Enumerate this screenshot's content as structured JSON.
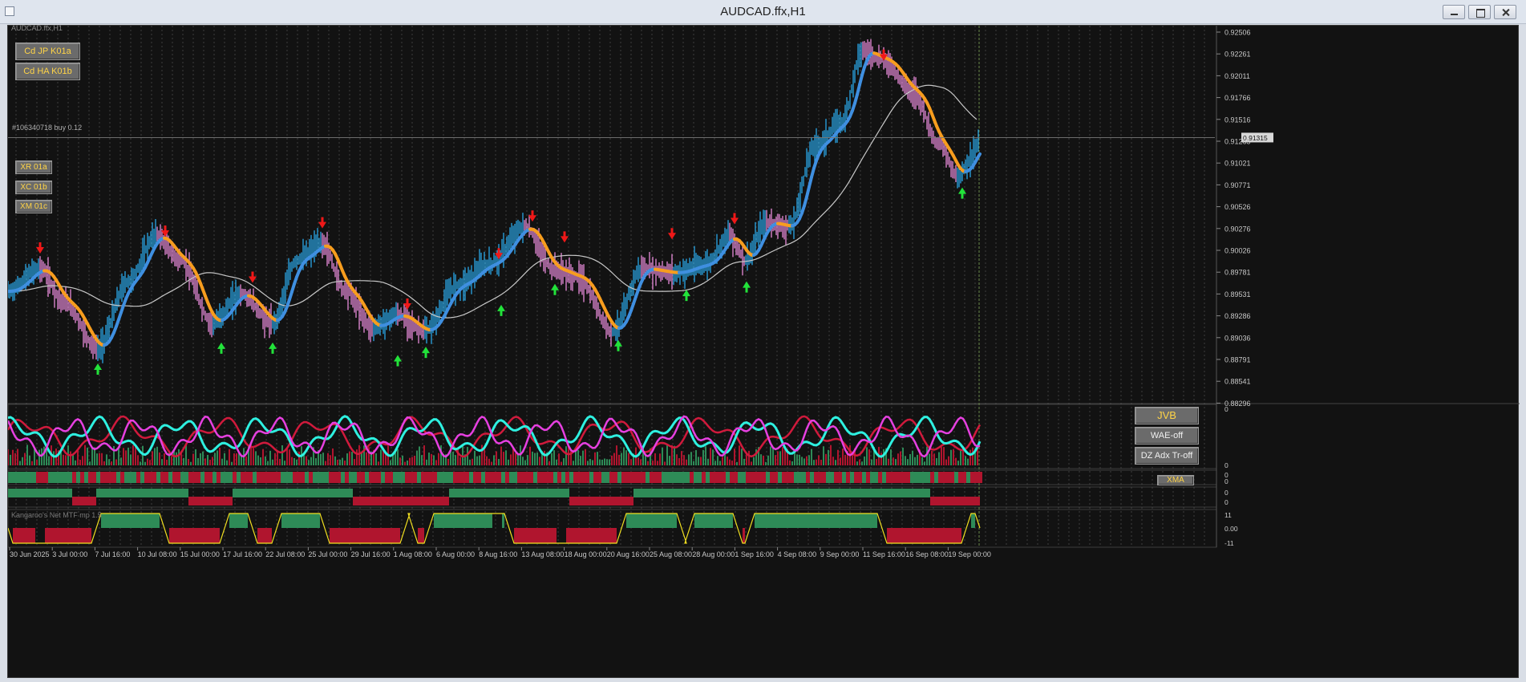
{
  "window": {
    "title": "AUDCAD.ffx,H1",
    "chart_label": "AUDCAD.ffx,H1"
  },
  "buttons": {
    "cd_jp": "Cd JP K01a",
    "cd_ha": "Cd HA K01b",
    "xr": "XR 01a",
    "xc": "XC 01b",
    "xm": "XM 01c",
    "jvb": "JVB",
    "wae": "WAE-off",
    "dz": "DZ Adx Tr-off",
    "xma": "XMA"
  },
  "order_label": "#106340718 buy 0.12",
  "current_price": "0.91315",
  "indicator_label": "Kangaroo's Net MTF mp 1.5",
  "price_axis": [
    "0.92506",
    "0.92261",
    "0.92011",
    "0.91766",
    "0.91516",
    "0.91265",
    "0.91021",
    "0.90771",
    "0.90526",
    "0.90276",
    "0.90026",
    "0.89781",
    "0.89531",
    "0.89286",
    "0.89036",
    "0.88791",
    "0.88541",
    "0.88296"
  ],
  "sub_axis": {
    "osc_top": "0",
    "osc_bottom": "0",
    "bar1_a": "0",
    "bar1_b": "0",
    "bar2_a": "0",
    "bar2_b": "0",
    "kn_top": "11",
    "kn_mid": "0.00",
    "kn_bottom": "-11"
  },
  "time_axis": [
    "30 Jun 2025",
    "3 Jul 00:00",
    "7 Jul 16:00",
    "10 Jul 08:00",
    "15 Jul 00:00",
    "17 Jul 16:00",
    "22 Jul 08:00",
    "25 Jul 00:00",
    "29 Jul 16:00",
    "1 Aug 08:00",
    "6 Aug 00:00",
    "8 Aug 16:00",
    "13 Aug 08:00",
    "18 Aug 00:00",
    "20 Aug 16:00",
    "25 Aug 08:00",
    "28 Aug 00:00",
    "1 Sep 16:00",
    "4 Sep 08:00",
    "9 Sep 00:00",
    "11 Sep 16:00",
    "16 Sep 08:00",
    "19 Sep 00:00"
  ],
  "colors": {
    "background": "#121212",
    "grid": "#5a5a5a",
    "up_candle": "#2aa7e6",
    "down_candle": "#e88ad9",
    "ma_up": "#3f8fe0",
    "ma_down": "#f79d1e",
    "slow_ma": "#c8c8c8",
    "arrow_up": "#22e23a",
    "arrow_down": "#f01818",
    "bull": "#2e8b57",
    "bear": "#b0152e",
    "osc_cyan": "#2ef0e0",
    "osc_magenta": "#e640e0",
    "osc_red": "#d01a3c"
  }
}
